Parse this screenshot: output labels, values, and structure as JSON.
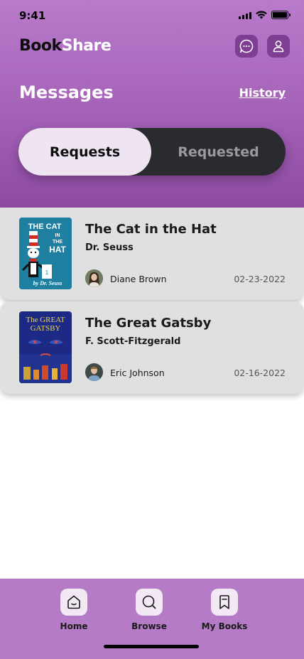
{
  "status_bar": {
    "time": "9:41"
  },
  "app": {
    "logo_part1": "Book",
    "logo_part2": "Share",
    "accent_color": "#a866bb"
  },
  "header": {
    "title": "Messages",
    "history_label": "History",
    "icons": [
      "chat-bubble-icon",
      "user-icon"
    ]
  },
  "segment": {
    "tabs": [
      {
        "label": "Requests",
        "active": true
      },
      {
        "label": "Requested",
        "active": false
      }
    ]
  },
  "requests": [
    {
      "title": "The Cat in the Hat",
      "author": "Dr. Seuss",
      "user": "Diane Brown",
      "date": "02-23-2022",
      "cover_text": [
        "THE CAT",
        "IN",
        "THE",
        "HAT",
        "by Dr. Seuss"
      ]
    },
    {
      "title": "The Great Gatsby",
      "author": "F. Scott-Fitzgerald",
      "user": "Eric Johnson",
      "date": "02-16-2022",
      "cover_text": [
        "The GREAT",
        "GATSBY"
      ]
    }
  ],
  "tabbar": {
    "items": [
      {
        "label": "Home",
        "icon": "home-icon"
      },
      {
        "label": "Browse",
        "icon": "search-icon"
      },
      {
        "label": "My Books",
        "icon": "bookmark-icon"
      }
    ]
  }
}
